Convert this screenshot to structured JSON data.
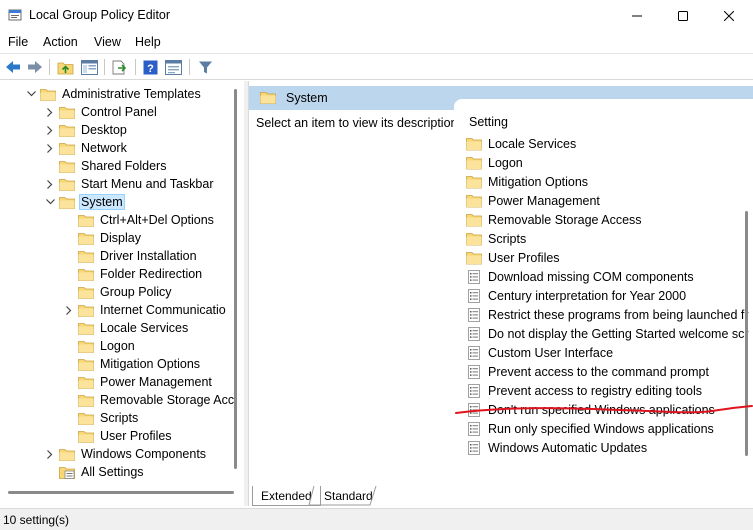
{
  "window": {
    "title": "Local Group Policy Editor",
    "controls": {
      "minimize": "minimize-icon",
      "maximize": "maximize-icon",
      "close": "close-icon"
    }
  },
  "menu": [
    "File",
    "Action",
    "View",
    "Help"
  ],
  "toolbar": [
    "back-arrow-icon",
    "forward-arrow-icon",
    "up-folder-icon",
    "show-hide-tree-icon",
    "export-list-icon",
    "help-icon",
    "properties-icon",
    "filter-icon"
  ],
  "tree": [
    {
      "label": "Administrative Templates",
      "indent": 1,
      "chevron": "down",
      "selected": false
    },
    {
      "label": "Control Panel",
      "indent": 2,
      "chevron": "right",
      "selected": false
    },
    {
      "label": "Desktop",
      "indent": 2,
      "chevron": "right",
      "selected": false
    },
    {
      "label": "Network",
      "indent": 2,
      "chevron": "right",
      "selected": false
    },
    {
      "label": "Shared Folders",
      "indent": 2,
      "chevron": "none",
      "selected": false
    },
    {
      "label": "Start Menu and Taskbar",
      "indent": 2,
      "chevron": "right",
      "selected": false
    },
    {
      "label": "System",
      "indent": 2,
      "chevron": "down",
      "selected": true
    },
    {
      "label": "Ctrl+Alt+Del Options",
      "indent": 3,
      "chevron": "none",
      "selected": false
    },
    {
      "label": "Display",
      "indent": 3,
      "chevron": "none",
      "selected": false
    },
    {
      "label": "Driver Installation",
      "indent": 3,
      "chevron": "none",
      "selected": false
    },
    {
      "label": "Folder Redirection",
      "indent": 3,
      "chevron": "none",
      "selected": false
    },
    {
      "label": "Group Policy",
      "indent": 3,
      "chevron": "none",
      "selected": false
    },
    {
      "label": "Internet Communicatio",
      "indent": 3,
      "chevron": "right",
      "selected": false
    },
    {
      "label": "Locale Services",
      "indent": 3,
      "chevron": "none",
      "selected": false
    },
    {
      "label": "Logon",
      "indent": 3,
      "chevron": "none",
      "selected": false
    },
    {
      "label": "Mitigation Options",
      "indent": 3,
      "chevron": "none",
      "selected": false
    },
    {
      "label": "Power Management",
      "indent": 3,
      "chevron": "none",
      "selected": false
    },
    {
      "label": "Removable Storage Acc",
      "indent": 3,
      "chevron": "none",
      "selected": false
    },
    {
      "label": "Scripts",
      "indent": 3,
      "chevron": "none",
      "selected": false
    },
    {
      "label": "User Profiles",
      "indent": 3,
      "chevron": "none",
      "selected": false
    },
    {
      "label": "Windows Components",
      "indent": 2,
      "chevron": "right",
      "selected": false
    },
    {
      "label": "All Settings",
      "indent": 2,
      "chevron": "none",
      "selected": false,
      "icon": "all-settings"
    }
  ],
  "details": {
    "header_title": "System",
    "description": "Select an item to view its description.",
    "column_header": "Setting",
    "items": [
      {
        "label": "Locale Services",
        "type": "folder"
      },
      {
        "label": "Logon",
        "type": "folder"
      },
      {
        "label": "Mitigation Options",
        "type": "folder"
      },
      {
        "label": "Power Management",
        "type": "folder"
      },
      {
        "label": "Removable Storage Access",
        "type": "folder"
      },
      {
        "label": "Scripts",
        "type": "folder"
      },
      {
        "label": "User Profiles",
        "type": "folder"
      },
      {
        "label": "Download missing COM components",
        "type": "setting"
      },
      {
        "label": "Century interpretation for Year 2000",
        "type": "setting"
      },
      {
        "label": "Restrict these programs from being launched fr",
        "type": "setting"
      },
      {
        "label": "Do not display the Getting Started welcome scr",
        "type": "setting"
      },
      {
        "label": "Custom User Interface",
        "type": "setting"
      },
      {
        "label": "Prevent access to the command prompt",
        "type": "setting"
      },
      {
        "label": "Prevent access to registry editing tools",
        "type": "setting"
      },
      {
        "label": "Don't run specified Windows applications",
        "type": "setting",
        "annotated": true
      },
      {
        "label": "Run only specified Windows applications",
        "type": "setting"
      },
      {
        "label": "Windows Automatic Updates",
        "type": "setting"
      }
    ]
  },
  "tabs": {
    "extended": "Extended",
    "standard": "Standard"
  },
  "status": {
    "text": "10 setting(s)"
  },
  "colors": {
    "selection": "#cce8ff",
    "header_band": "#bcd6ee",
    "folder": "#f8d775",
    "annotation": "#e0141e",
    "toolbar_blue": "#2c78c8"
  }
}
